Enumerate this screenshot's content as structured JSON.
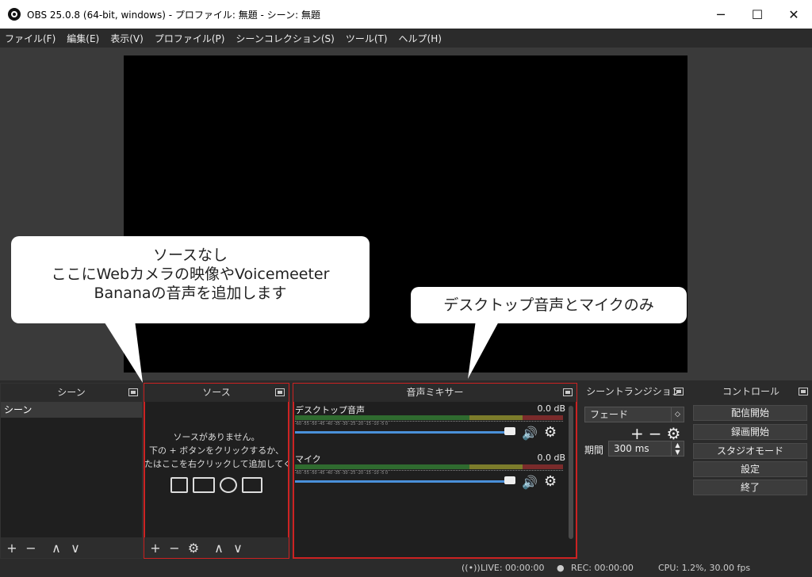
{
  "window": {
    "title": "OBS 25.0.8 (64-bit, windows) - プロファイル: 無題 - シーン: 無題",
    "minimize": "─",
    "maximize": "☐",
    "close": "✕"
  },
  "menu": [
    "ファイル(F)",
    "編集(E)",
    "表示(V)",
    "プロファイル(P)",
    "シーンコレクション(S)",
    "ツール(T)",
    "ヘルプ(H)"
  ],
  "scenes": {
    "title": "シーン",
    "items": [
      "シーン"
    ],
    "toolbar": [
      "+",
      "−",
      "∧",
      "∨"
    ]
  },
  "sources": {
    "title": "ソース",
    "empty_line1": "ソースがありません。",
    "empty_line2": "下の + ボタンをクリックするか、",
    "empty_line3": "たはここを右クリックして追加してくださ",
    "toolbar": [
      "+",
      "−",
      "⚙",
      "∧",
      "∨"
    ]
  },
  "mixer": {
    "title": "音声ミキサー",
    "channels": [
      {
        "name": "デスクトップ音声",
        "db": "0.0 dB"
      },
      {
        "name": "マイク",
        "db": "0.0 dB"
      }
    ],
    "ticks": "-60 -55 -50 -45 -40 -35 -30 -25 -20 -15 -10 -5 0"
  },
  "transitions": {
    "title": "シーントランジション",
    "selected": "フェード",
    "duration_label": "期間",
    "duration_value": "300 ms",
    "tools": [
      "+",
      "−",
      "⚙"
    ]
  },
  "controls": {
    "title": "コントロール",
    "buttons": [
      "配信開始",
      "録画開始",
      "スタジオモード",
      "設定",
      "終了"
    ]
  },
  "status": {
    "live": "LIVE: 00:00:00",
    "rec": "REC: 00:00:00",
    "cpu": "CPU: 1.2%, 30.00 fps"
  },
  "callouts": {
    "sources_line1": "ソースなし",
    "sources_line2": "ここにWebカメラの映像やVoicemeeter",
    "sources_line3": "Bananaの音声を追加します",
    "mixer": "デスクトップ音声とマイクのみ"
  }
}
